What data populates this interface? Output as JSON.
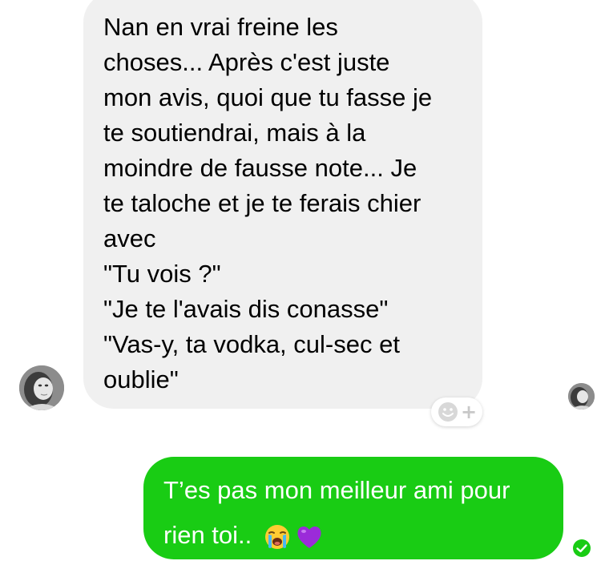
{
  "incoming_message": {
    "lines": [
      "Nan en vrai freine les",
      "choses... Après c'est juste",
      "mon avis, quoi que tu fasse je",
      "te soutiendrai, mais à la",
      "moindre de fausse note... Je",
      "te taloche et je te ferais chier",
      "avec",
      "\"Tu vois ?\"",
      "\"Je te l'avais dis conasse\"",
      "\"Vas-y, ta vodka, cul-sec et",
      "oublie\""
    ]
  },
  "reaction_button": {
    "icon": "smiley-add-icon",
    "plus": "+"
  },
  "outgoing_message": {
    "line1": "T’es pas mon meilleur ami pour",
    "line2": "rien toi.. ",
    "emojis": [
      "crying-face-icon",
      "purple-heart-icon"
    ],
    "status_icon": "delivered-check-icon"
  },
  "colors": {
    "incoming_bubble": "#f0f0f0",
    "outgoing_bubble": "#19cc14",
    "status_green": "#19cc14"
  }
}
